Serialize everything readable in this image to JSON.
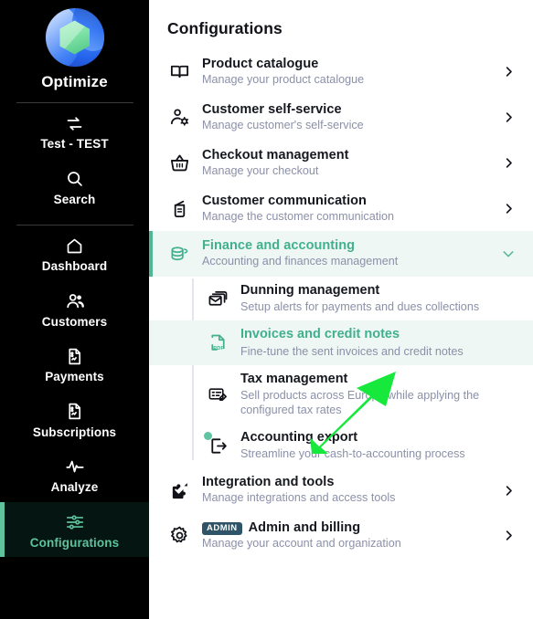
{
  "sidebar": {
    "brand": {
      "name": "Optimize",
      "logo_icon": "optimize-logo"
    },
    "groups": [
      {
        "items": [
          {
            "label": "Test - TEST",
            "icon": "switch-arrows-icon",
            "active": false
          },
          {
            "label": "Search",
            "icon": "search-icon",
            "active": false
          }
        ]
      },
      {
        "items": [
          {
            "label": "Dashboard",
            "icon": "home-icon",
            "active": false
          },
          {
            "label": "Customers",
            "icon": "users-icon",
            "active": false
          },
          {
            "label": "Payments",
            "icon": "document-chart-icon",
            "active": false
          },
          {
            "label": "Subscriptions",
            "icon": "document-chart-icon",
            "active": false
          },
          {
            "label": "Analyze",
            "icon": "pulse-icon",
            "active": false
          },
          {
            "label": "Configurations",
            "icon": "sliders-icon",
            "active": true
          }
        ]
      }
    ]
  },
  "main": {
    "title": "Configurations",
    "items": [
      {
        "title": "Product catalogue",
        "subtitle": "Manage your product catalogue",
        "icon": "open-book-icon",
        "chevron": "chevron-right-icon",
        "expanded": false
      },
      {
        "title": "Customer self-service",
        "subtitle": "Manage customer's self-service",
        "icon": "user-gear-icon",
        "chevron": "chevron-right-icon",
        "expanded": false
      },
      {
        "title": "Checkout management",
        "subtitle": "Manage your checkout",
        "icon": "shopping-basket-icon",
        "chevron": "chevron-right-icon",
        "expanded": false
      },
      {
        "title": "Customer communication",
        "subtitle": "Manage the customer communication",
        "icon": "megaphone-icon",
        "chevron": "chevron-right-icon",
        "expanded": false
      },
      {
        "title": "Finance and accounting",
        "subtitle": "Accounting and finances management",
        "icon": "coins-stack-icon",
        "chevron": "chevron-down-icon",
        "expanded": true
      }
    ],
    "subitems": [
      {
        "title": "Dunning management",
        "subtitle": "Setup alerts for payments and dues collections",
        "icon": "mail-stack-icon",
        "selected": false,
        "dot": false
      },
      {
        "title": "Invoices and credit notes",
        "subtitle": "Fine-tune the sent invoices and credit notes",
        "icon": "pdf-file-icon",
        "icon_text": "PDF",
        "selected": true,
        "dot": false
      },
      {
        "title": "Tax management",
        "subtitle": "Sell products across Europe while applying the configured tax rates",
        "icon": "tax-edit-icon",
        "selected": false,
        "dot": false
      },
      {
        "title": "Accounting export",
        "subtitle": "Streamline your cash-to-accounting process",
        "icon": "export-arrow-icon",
        "selected": false,
        "dot": true
      }
    ],
    "items_after": [
      {
        "title": "Integration and tools",
        "subtitle": "Manage integrations and access tools",
        "icon": "puzzle-icon",
        "chevron": "chevron-right-icon",
        "badge": null
      },
      {
        "title": "Admin and billing",
        "subtitle": "Manage your account and organization",
        "icon": "gear-icon",
        "chevron": "chevron-right-icon",
        "badge": "ADMIN"
      }
    ]
  },
  "annotation": {
    "arrow_icon": "green-arrow-pointer",
    "color": "#16e83c"
  },
  "colors": {
    "sidebar_bg": "#000000",
    "accent_green": "#41b08d",
    "accent_bar": "#4fb696",
    "highlight_bg": "#eef7f4",
    "subtitle": "#8b90a8",
    "badge_bg": "#2f5468",
    "annotation_green": "#16e83c"
  }
}
